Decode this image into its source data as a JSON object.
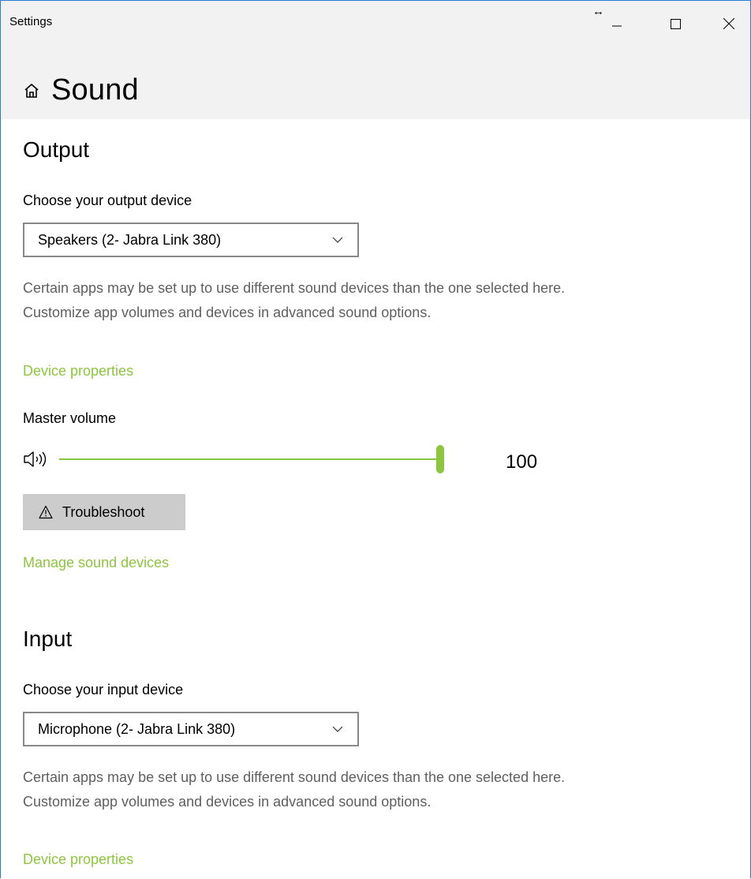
{
  "window": {
    "title": "Settings",
    "controls": {
      "minimize": "–",
      "maximize": "☐",
      "close": "✕",
      "resize": "↔"
    }
  },
  "page": {
    "title": "Sound",
    "icon": "home-icon"
  },
  "output": {
    "section_title": "Output",
    "device_label": "Choose your output device",
    "device_selected": "Speakers (2- Jabra Link 380)",
    "description": "Certain apps may be set up to use different sound devices than the one selected here. Customize app volumes and devices in advanced sound options.",
    "device_properties_link": "Device properties",
    "master_volume_label": "Master volume",
    "volume_value": "100",
    "volume_level": 100,
    "troubleshoot_label": "Troubleshoot",
    "manage_devices_link": "Manage sound devices"
  },
  "input": {
    "section_title": "Input",
    "device_label": "Choose your input device",
    "device_selected": "Microphone (2- Jabra Link 380)",
    "description": "Certain apps may be set up to use different sound devices than the one selected here. Customize app volumes and devices in advanced sound options.",
    "device_properties_link": "Device properties"
  },
  "colors": {
    "accent": "#8cc63f",
    "titlebar_bg": "#f2f2f2",
    "button_bg": "#cccccc",
    "secondary_text": "#5f5f5f",
    "border": "#2b7bd3"
  }
}
